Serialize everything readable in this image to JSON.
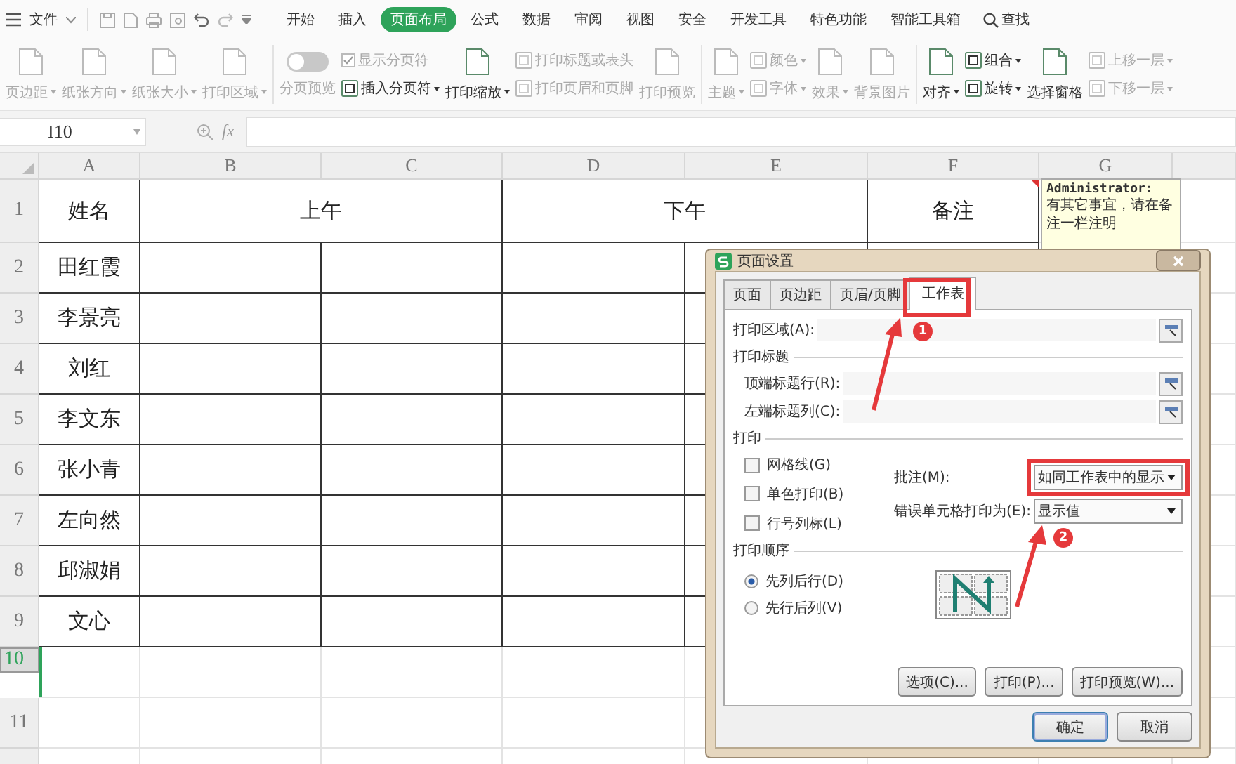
{
  "menu": {
    "file": "文件",
    "tabs": [
      {
        "label": "开始",
        "selected": false
      },
      {
        "label": "插入",
        "selected": false
      },
      {
        "label": "页面布局",
        "selected": true
      },
      {
        "label": "公式",
        "selected": false
      },
      {
        "label": "数据",
        "selected": false
      },
      {
        "label": "审阅",
        "selected": false
      },
      {
        "label": "视图",
        "selected": false
      },
      {
        "label": "安全",
        "selected": false
      },
      {
        "label": "开发工具",
        "selected": false
      },
      {
        "label": "特色功能",
        "selected": false
      },
      {
        "label": "智能工具箱",
        "selected": false
      }
    ],
    "search": "查找"
  },
  "ribbon": [
    {
      "kind": "large",
      "label": "页边距",
      "disabled": true,
      "dropdown": true
    },
    {
      "kind": "large",
      "label": "纸张方向",
      "disabled": true,
      "dropdown": true
    },
    {
      "kind": "large",
      "label": "纸张大小",
      "disabled": true,
      "dropdown": true
    },
    {
      "kind": "large",
      "label": "打印区域",
      "disabled": true,
      "dropdown": true
    },
    {
      "kind": "separator"
    },
    {
      "kind": "toggle",
      "label": "分页预览",
      "disabled": true,
      "on": false
    },
    {
      "kind": "stack",
      "items": [
        {
          "kind": "check",
          "label": "显示分页符",
          "disabled": true,
          "checked": true
        },
        {
          "kind": "button",
          "label": "插入分页符",
          "disabled": false,
          "dropdown": true
        }
      ]
    },
    {
      "kind": "large",
      "label": "打印缩放",
      "disabled": false,
      "dropdown": true
    },
    {
      "kind": "stack",
      "items": [
        {
          "kind": "button",
          "label": "打印标题或表头",
          "disabled": true,
          "dropdown": false
        },
        {
          "kind": "button",
          "label": "打印页眉和页脚",
          "disabled": true,
          "dropdown": false
        }
      ]
    },
    {
      "kind": "large",
      "label": "打印预览",
      "disabled": true,
      "dropdown": false
    },
    {
      "kind": "separator"
    },
    {
      "kind": "large",
      "label": "主题",
      "disabled": true,
      "dropdown": true
    },
    {
      "kind": "stack",
      "items": [
        {
          "kind": "button",
          "label": "颜色",
          "disabled": true,
          "dropdown": true
        },
        {
          "kind": "button",
          "label": "字体",
          "disabled": true,
          "dropdown": true
        }
      ]
    },
    {
      "kind": "large",
      "label": "效果",
      "disabled": true,
      "dropdown": true
    },
    {
      "kind": "large",
      "label": "背景图片",
      "disabled": true,
      "dropdown": false
    },
    {
      "kind": "separator"
    },
    {
      "kind": "large",
      "label": "对齐",
      "disabled": false,
      "dropdown": true
    },
    {
      "kind": "stack",
      "items": [
        {
          "kind": "button",
          "label": "组合",
          "disabled": false,
          "dropdown": true
        },
        {
          "kind": "button",
          "label": "旋转",
          "disabled": false,
          "dropdown": true
        }
      ]
    },
    {
      "kind": "large",
      "label": "选择窗格",
      "disabled": false,
      "dropdown": false
    },
    {
      "kind": "stack",
      "items": [
        {
          "kind": "button",
          "label": "上移一层",
          "disabled": true,
          "dropdown": true
        },
        {
          "kind": "button",
          "label": "下移一层",
          "disabled": true,
          "dropdown": true
        }
      ]
    }
  ],
  "formula_bar": {
    "name_box": "I10",
    "fx": "fx"
  },
  "sheet": {
    "columns": [
      "A",
      "B",
      "C",
      "D",
      "E",
      "F",
      "G"
    ],
    "rows": [
      {
        "number": "1",
        "selected": false,
        "bordered": true,
        "cells": [
          {
            "text": "姓名",
            "merged": false
          },
          {
            "text": "上午",
            "merged": true
          },
          {
            "text": "下午",
            "merged": true
          },
          {
            "text": "备注",
            "merged": false
          }
        ]
      },
      {
        "number": "2",
        "selected": false,
        "bordered": true,
        "cells": [
          {
            "text": "田红霞",
            "merged": false
          }
        ]
      },
      {
        "number": "3",
        "selected": false,
        "bordered": true,
        "cells": [
          {
            "text": "李景亮",
            "merged": false
          }
        ]
      },
      {
        "number": "4",
        "selected": false,
        "bordered": true,
        "cells": [
          {
            "text": "刘红",
            "merged": false
          }
        ]
      },
      {
        "number": "5",
        "selected": false,
        "bordered": true,
        "cells": [
          {
            "text": "李文东",
            "merged": false
          }
        ]
      },
      {
        "number": "6",
        "selected": false,
        "bordered": true,
        "cells": [
          {
            "text": "张小青",
            "merged": false
          }
        ]
      },
      {
        "number": "7",
        "selected": false,
        "bordered": true,
        "cells": [
          {
            "text": "左向然",
            "merged": false
          }
        ]
      },
      {
        "number": "8",
        "selected": false,
        "bordered": true,
        "cells": [
          {
            "text": "邱淑娟",
            "merged": false
          }
        ]
      },
      {
        "number": "9",
        "selected": false,
        "bordered": true,
        "cells": [
          {
            "text": "文心",
            "merged": false
          }
        ]
      },
      {
        "number": "10",
        "selected": true,
        "bordered": false
      },
      {
        "number": "11",
        "selected": false,
        "bordered": false
      }
    ],
    "comment": {
      "author": "Administrator:",
      "text": "有其它事宜，请在备注一栏注明"
    }
  },
  "dialog": {
    "title": "页面设置",
    "tabs": [
      {
        "label": "页面",
        "selected": false
      },
      {
        "label": "页边距",
        "selected": false
      },
      {
        "label": "页眉/页脚",
        "selected": false
      },
      {
        "label": "工作表",
        "selected": true
      }
    ],
    "print_area": "打印区域(A):",
    "print_titles": {
      "heading": "打印标题",
      "fields": [
        "顶端标题行(R):",
        "左端标题列(C):"
      ]
    },
    "print": {
      "heading": "打印",
      "checkboxes": [
        {
          "label": "网格线(G)",
          "checked": false
        },
        {
          "label": "单色打印(B)",
          "checked": false
        },
        {
          "label": "行号列标(L)",
          "checked": false
        }
      ],
      "selects": [
        {
          "label": "批注(M):",
          "value": "如同工作表中的显示"
        },
        {
          "label": "错误单元格打印为(E):",
          "value": "显示值"
        }
      ]
    },
    "order": {
      "heading": "打印顺序",
      "options": [
        {
          "label": "先列后行(D)",
          "selected": true
        },
        {
          "label": "先行后列(V)",
          "selected": false
        }
      ]
    },
    "buttons": [
      "选项(C)...",
      "打印(P)...",
      "打印预览(W)..."
    ],
    "footer": [
      {
        "label": "确定",
        "default": true
      },
      {
        "label": "取消",
        "default": false
      }
    ]
  },
  "annotations": [
    "1",
    "2"
  ]
}
